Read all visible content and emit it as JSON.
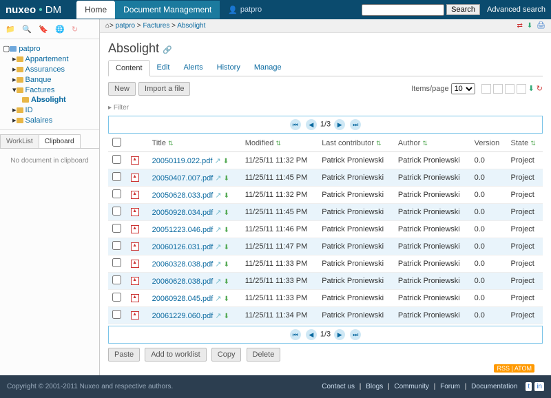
{
  "brand": {
    "name": "nuxeo",
    "suffix": "DM"
  },
  "top_tabs": {
    "home": "Home",
    "dm": "Document Management"
  },
  "user": "patpro",
  "search": {
    "placeholder": "",
    "button": "Search",
    "advanced": "Advanced search"
  },
  "breadcrumb": {
    "root_icon": "home",
    "items": [
      "patpro",
      "Factures",
      "Absolight"
    ]
  },
  "tree": {
    "root": "patpro",
    "nodes": [
      {
        "label": "Appartement"
      },
      {
        "label": "Assurances"
      },
      {
        "label": "Banque"
      },
      {
        "label": "Factures",
        "children": [
          {
            "label": "Absolight",
            "selected": true
          }
        ]
      },
      {
        "label": "ID"
      },
      {
        "label": "Salaires"
      }
    ]
  },
  "side_tabs": {
    "worklist": "WorkList",
    "clipboard": "Clipboard"
  },
  "clipboard_empty": "No document in clipboard",
  "title": "Absolight",
  "content_tabs": {
    "content": "Content",
    "edit": "Edit",
    "alerts": "Alerts",
    "history": "History",
    "manage": "Manage"
  },
  "actions": {
    "new": "New",
    "import": "Import a file"
  },
  "items_page": {
    "label": "Items/page",
    "value": "10"
  },
  "filter_label": "Filter",
  "pager": {
    "current": "1",
    "total": "3"
  },
  "columns": {
    "title": "Title",
    "modified": "Modified",
    "contributor": "Last contributor",
    "author": "Author",
    "version": "Version",
    "state": "State"
  },
  "rows": [
    {
      "title": "20050119.022.pdf",
      "modified": "11/25/11 11:32 PM",
      "contributor": "Patrick Proniewski",
      "author": "Patrick Proniewski",
      "version": "0.0",
      "state": "Project"
    },
    {
      "title": "20050407.007.pdf",
      "modified": "11/25/11 11:45 PM",
      "contributor": "Patrick Proniewski",
      "author": "Patrick Proniewski",
      "version": "0.0",
      "state": "Project"
    },
    {
      "title": "20050628.033.pdf",
      "modified": "11/25/11 11:32 PM",
      "contributor": "Patrick Proniewski",
      "author": "Patrick Proniewski",
      "version": "0.0",
      "state": "Project"
    },
    {
      "title": "20050928.034.pdf",
      "modified": "11/25/11 11:45 PM",
      "contributor": "Patrick Proniewski",
      "author": "Patrick Proniewski",
      "version": "0.0",
      "state": "Project"
    },
    {
      "title": "20051223.046.pdf",
      "modified": "11/25/11 11:46 PM",
      "contributor": "Patrick Proniewski",
      "author": "Patrick Proniewski",
      "version": "0.0",
      "state": "Project"
    },
    {
      "title": "20060126.031.pdf",
      "modified": "11/25/11 11:47 PM",
      "contributor": "Patrick Proniewski",
      "author": "Patrick Proniewski",
      "version": "0.0",
      "state": "Project"
    },
    {
      "title": "20060328.038.pdf",
      "modified": "11/25/11 11:33 PM",
      "contributor": "Patrick Proniewski",
      "author": "Patrick Proniewski",
      "version": "0.0",
      "state": "Project"
    },
    {
      "title": "20060628.038.pdf",
      "modified": "11/25/11 11:33 PM",
      "contributor": "Patrick Proniewski",
      "author": "Patrick Proniewski",
      "version": "0.0",
      "state": "Project"
    },
    {
      "title": "20060928.045.pdf",
      "modified": "11/25/11 11:33 PM",
      "contributor": "Patrick Proniewski",
      "author": "Patrick Proniewski",
      "version": "0.0",
      "state": "Project"
    },
    {
      "title": "20061229.060.pdf",
      "modified": "11/25/11 11:34 PM",
      "contributor": "Patrick Proniewski",
      "author": "Patrick Proniewski",
      "version": "0.0",
      "state": "Project"
    }
  ],
  "bottom_actions": {
    "paste": "Paste",
    "add": "Add to worklist",
    "copy": "Copy",
    "delete": "Delete"
  },
  "rss": "RSS | ATOM",
  "footer": {
    "copyright": "Copyright © 2001-2011 Nuxeo and respective authors.",
    "links": [
      "Contact us",
      "Blogs",
      "Community",
      "Forum",
      "Documentation"
    ]
  }
}
